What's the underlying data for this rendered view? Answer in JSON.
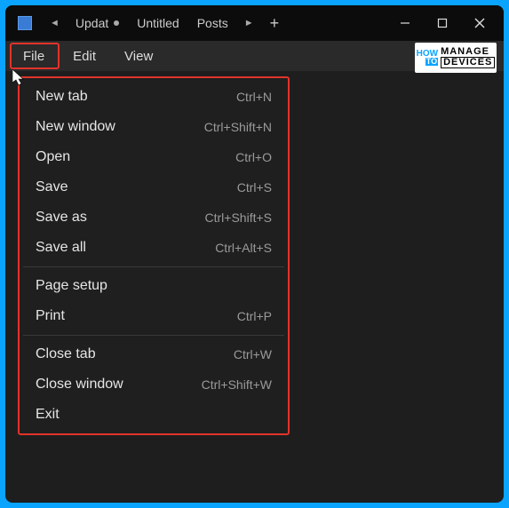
{
  "titlebar": {
    "tabs": [
      {
        "label": "Updat",
        "modified": true
      },
      {
        "label": "Untitled",
        "modified": false
      },
      {
        "label": "Posts",
        "modified": false
      }
    ]
  },
  "menubar": {
    "file": "File",
    "edit": "Edit",
    "view": "View"
  },
  "watermark": {
    "how": "HOW",
    "to": "TO",
    "manage": "MANAGE",
    "devices": "DEVICES"
  },
  "file_menu": {
    "groups": [
      [
        {
          "label": "New tab",
          "shortcut": "Ctrl+N"
        },
        {
          "label": "New window",
          "shortcut": "Ctrl+Shift+N"
        },
        {
          "label": "Open",
          "shortcut": "Ctrl+O"
        },
        {
          "label": "Save",
          "shortcut": "Ctrl+S"
        },
        {
          "label": "Save as",
          "shortcut": "Ctrl+Shift+S"
        },
        {
          "label": "Save all",
          "shortcut": "Ctrl+Alt+S"
        }
      ],
      [
        {
          "label": "Page setup",
          "shortcut": ""
        },
        {
          "label": "Print",
          "shortcut": "Ctrl+P"
        }
      ],
      [
        {
          "label": "Close tab",
          "shortcut": "Ctrl+W"
        },
        {
          "label": "Close window",
          "shortcut": "Ctrl+Shift+W"
        },
        {
          "label": "Exit",
          "shortcut": ""
        }
      ]
    ]
  }
}
